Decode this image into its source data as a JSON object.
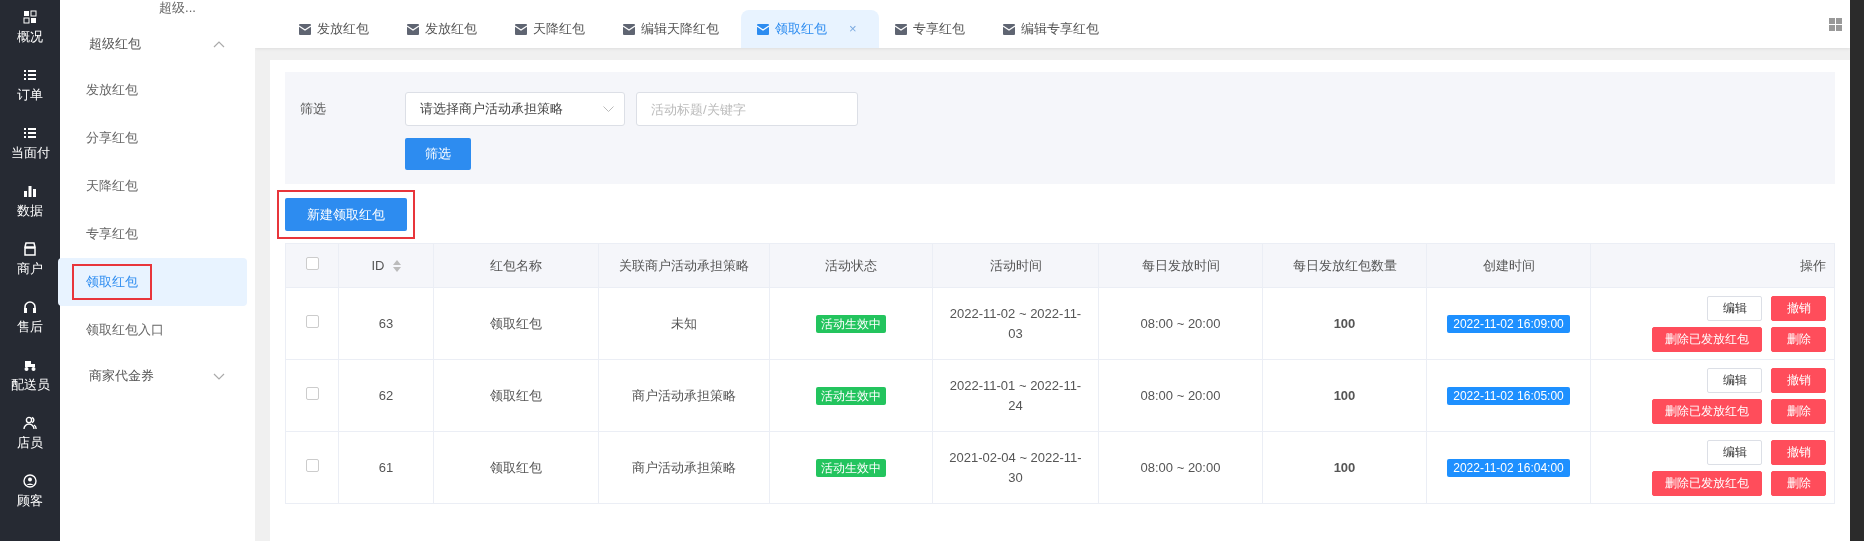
{
  "rail": {
    "items": [
      {
        "label": "概况",
        "selected": false
      },
      {
        "label": "订单",
        "selected": false
      },
      {
        "label": "当面付",
        "selected": false
      },
      {
        "label": "数据",
        "selected": false
      },
      {
        "label": "商户",
        "selected": false
      },
      {
        "label": "售后",
        "selected": false
      },
      {
        "label": "配送员",
        "selected": false
      },
      {
        "label": "店员",
        "selected": false
      },
      {
        "label": "顾客",
        "selected": false
      }
    ]
  },
  "sidebar": {
    "cut_item": "超级...",
    "groups": [
      {
        "label": "超级红包",
        "expanded": true,
        "items": [
          {
            "label": "发放红包",
            "selected": false,
            "highlighted": false
          },
          {
            "label": "分享红包",
            "selected": false,
            "highlighted": false
          },
          {
            "label": "天降红包",
            "selected": false,
            "highlighted": false
          },
          {
            "label": "专享红包",
            "selected": false,
            "highlighted": false
          },
          {
            "label": "领取红包",
            "selected": true,
            "highlighted": true
          },
          {
            "label": "领取红包入口",
            "selected": false,
            "highlighted": false
          }
        ]
      },
      {
        "label": "商家代金券",
        "expanded": false
      }
    ]
  },
  "tabs": [
    {
      "label": "发放红包",
      "selected": false
    },
    {
      "label": "发放红包",
      "selected": false
    },
    {
      "label": "天降红包",
      "selected": false
    },
    {
      "label": "编辑天降红包",
      "selected": false
    },
    {
      "label": "领取红包",
      "selected": true,
      "close": "×"
    },
    {
      "label": "专享红包",
      "selected": false
    },
    {
      "label": "编辑专享红包",
      "selected": false
    }
  ],
  "filter": {
    "label": "筛选",
    "select": {
      "value": "请选择商户活动承担策略"
    },
    "input": {
      "placeholder": "活动标题/关键字"
    },
    "button": "筛选"
  },
  "new_button": {
    "label": "新建领取红包",
    "highlighted": true
  },
  "table": {
    "select_all_checked": false,
    "columns": [
      "ID",
      "红包名称",
      "关联商户活动承担策略",
      "活动状态",
      "活动时间",
      "每日发放时间",
      "每日发放红包数量",
      "创建时间",
      "操作"
    ],
    "rows": [
      {
        "checked": false,
        "id": "63",
        "name": "领取红包",
        "strategy": "未知",
        "status": "活动生效中",
        "activity_time": "2022-11-02 ~ 2022-11-03",
        "daily_time": "08:00 ~ 20:00",
        "count": "100",
        "created": "2022-11-02 16:09:00",
        "actions": [
          {
            "label": "编辑",
            "kind": "outline"
          },
          {
            "label": "撤销",
            "kind": "danger"
          },
          {
            "label": "删除已发放红包",
            "kind": "danger"
          },
          {
            "label": "删除",
            "kind": "danger"
          }
        ]
      },
      {
        "checked": false,
        "id": "62",
        "name": "领取红包",
        "strategy": "商户活动承担策略",
        "status": "活动生效中",
        "activity_time": "2022-11-01 ~ 2022-11-24",
        "daily_time": "08:00 ~ 20:00",
        "count": "100",
        "created": "2022-11-02 16:05:00",
        "actions": [
          {
            "label": "编辑",
            "kind": "outline"
          },
          {
            "label": "撤销",
            "kind": "danger"
          },
          {
            "label": "删除已发放红包",
            "kind": "danger"
          },
          {
            "label": "删除",
            "kind": "danger"
          }
        ]
      },
      {
        "checked": false,
        "id": "61",
        "name": "领取红包",
        "strategy": "商户活动承担策略",
        "status": "活动生效中",
        "activity_time": "2021-02-04 ~ 2022-11-30",
        "daily_time": "08:00 ~ 20:00",
        "count": "100",
        "created": "2022-11-02 16:04:00",
        "actions": [
          {
            "label": "编辑",
            "kind": "outline"
          },
          {
            "label": "撤销",
            "kind": "danger"
          },
          {
            "label": "删除已发放红包",
            "kind": "danger"
          },
          {
            "label": "删除",
            "kind": "danger"
          }
        ]
      }
    ]
  }
}
